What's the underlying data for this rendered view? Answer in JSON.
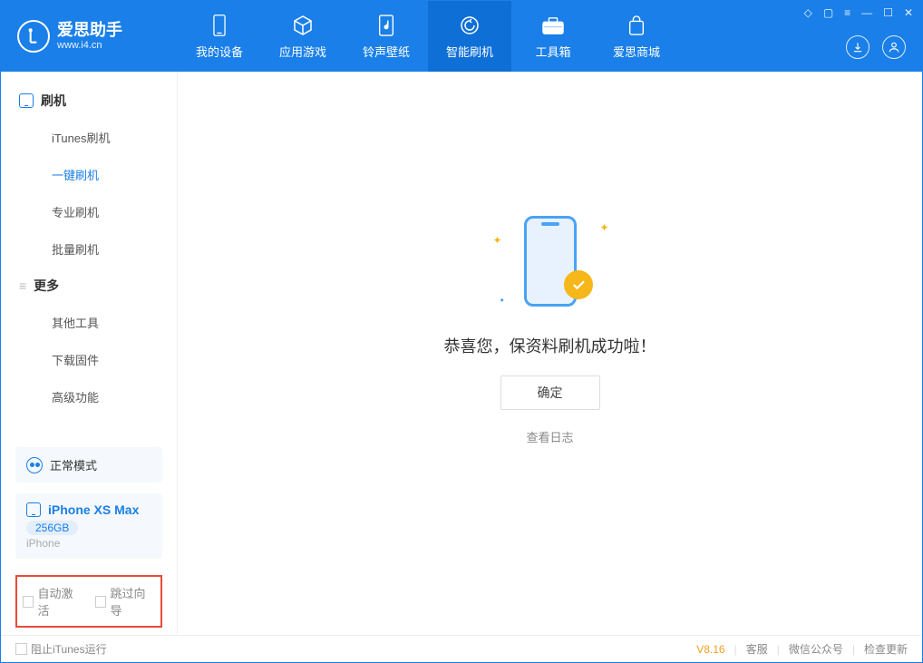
{
  "brand": {
    "title": "爱思助手",
    "sub": "www.i4.cn"
  },
  "tabs": [
    {
      "label": "我的设备",
      "icon": "device"
    },
    {
      "label": "应用游戏",
      "icon": "cube"
    },
    {
      "label": "铃声壁纸",
      "icon": "music"
    },
    {
      "label": "智能刷机",
      "icon": "shield",
      "active": true
    },
    {
      "label": "工具箱",
      "icon": "toolbox"
    },
    {
      "label": "爱思商城",
      "icon": "bag"
    }
  ],
  "sidebar": {
    "group1": {
      "title": "刷机",
      "items": [
        "iTunes刷机",
        "一键刷机",
        "专业刷机",
        "批量刷机"
      ],
      "activeIndex": 1
    },
    "group2": {
      "title": "更多",
      "items": [
        "其他工具",
        "下载固件",
        "高级功能"
      ]
    }
  },
  "status": {
    "label": "正常模式"
  },
  "device": {
    "name": "iPhone XS Max",
    "storage": "256GB",
    "type": "iPhone"
  },
  "highlight": {
    "opt1": "自动激活",
    "opt2": "跳过向导"
  },
  "main": {
    "success": "恭喜您，保资料刷机成功啦！",
    "ok": "确定",
    "log": "查看日志"
  },
  "footer": {
    "block_itunes": "阻止iTunes运行",
    "version": "V8.16",
    "links": [
      "客服",
      "微信公众号",
      "检查更新"
    ]
  }
}
